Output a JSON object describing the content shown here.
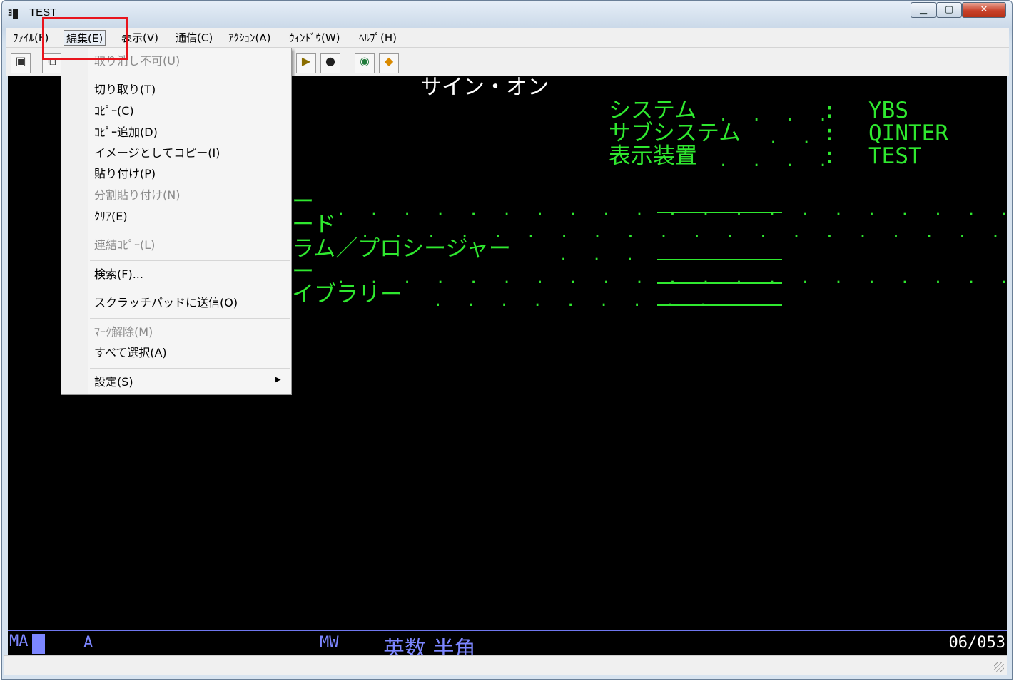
{
  "window": {
    "title": "TEST"
  },
  "title_controls": {
    "minimize": "▁",
    "maximize": "▢",
    "close": "✕"
  },
  "menubar": {
    "file": "ﾌｧｲﾙ(F)",
    "edit": "編集(E)",
    "view": "表示(V)",
    "comm": "通信(C)",
    "action": "ｱｸｼｮﾝ(A)",
    "window": "ｳｨﾝﾄﾞｳ(W)",
    "help": "ﾍﾙﾌﾟ(H)"
  },
  "toolbar_icons": [
    "screen-icon",
    "copy-screen-icon",
    "macro-play-icon",
    "macro-record-icon",
    "globe-icon",
    "settings-tag-icon"
  ],
  "edit_menu": {
    "undo": "取り消し不可(U)",
    "cut": "切り取り(T)",
    "copy": "ｺﾋﾟｰ(C)",
    "copy_append": "ｺﾋﾟｰ追加(D)",
    "copy_image": "イメージとしてコピー(I)",
    "paste": "貼り付け(P)",
    "paste_split": "分割貼り付け(N)",
    "clear": "ｸﾘｱ(E)",
    "linked_copy": "連結ｺﾋﾟｰ(L)",
    "find": "検索(F)...",
    "send_scratchpad": "スクラッチパッドに送信(O)",
    "unmark": "ﾏｰｸ解除(M)",
    "select_all": "すべて選択(A)",
    "settings": "設定(S)"
  },
  "terminal": {
    "title": "サイン・オン",
    "system_label": "システム",
    "subsystem_label": "サブシステム",
    "display_label": "表示装置",
    "system_value": "YBS",
    "subsystem_value": "QINTER",
    "display_value": "TEST",
    "row1_label": "ー",
    "row2_label": "ード",
    "row3_label": "ラム／プロシージャー",
    "row4_label": "ー",
    "row5_label": "イブラリー",
    "colon": ":"
  },
  "statusline": {
    "mode": "MA",
    "field_attr": "A",
    "mw": "MW",
    "ime": "英数 半角",
    "cursor_pos": "06/053"
  },
  "colors": {
    "terminal_green": "#2fe82f",
    "status_blue": "#7c86ff",
    "highlight_red": "#e8141d"
  }
}
